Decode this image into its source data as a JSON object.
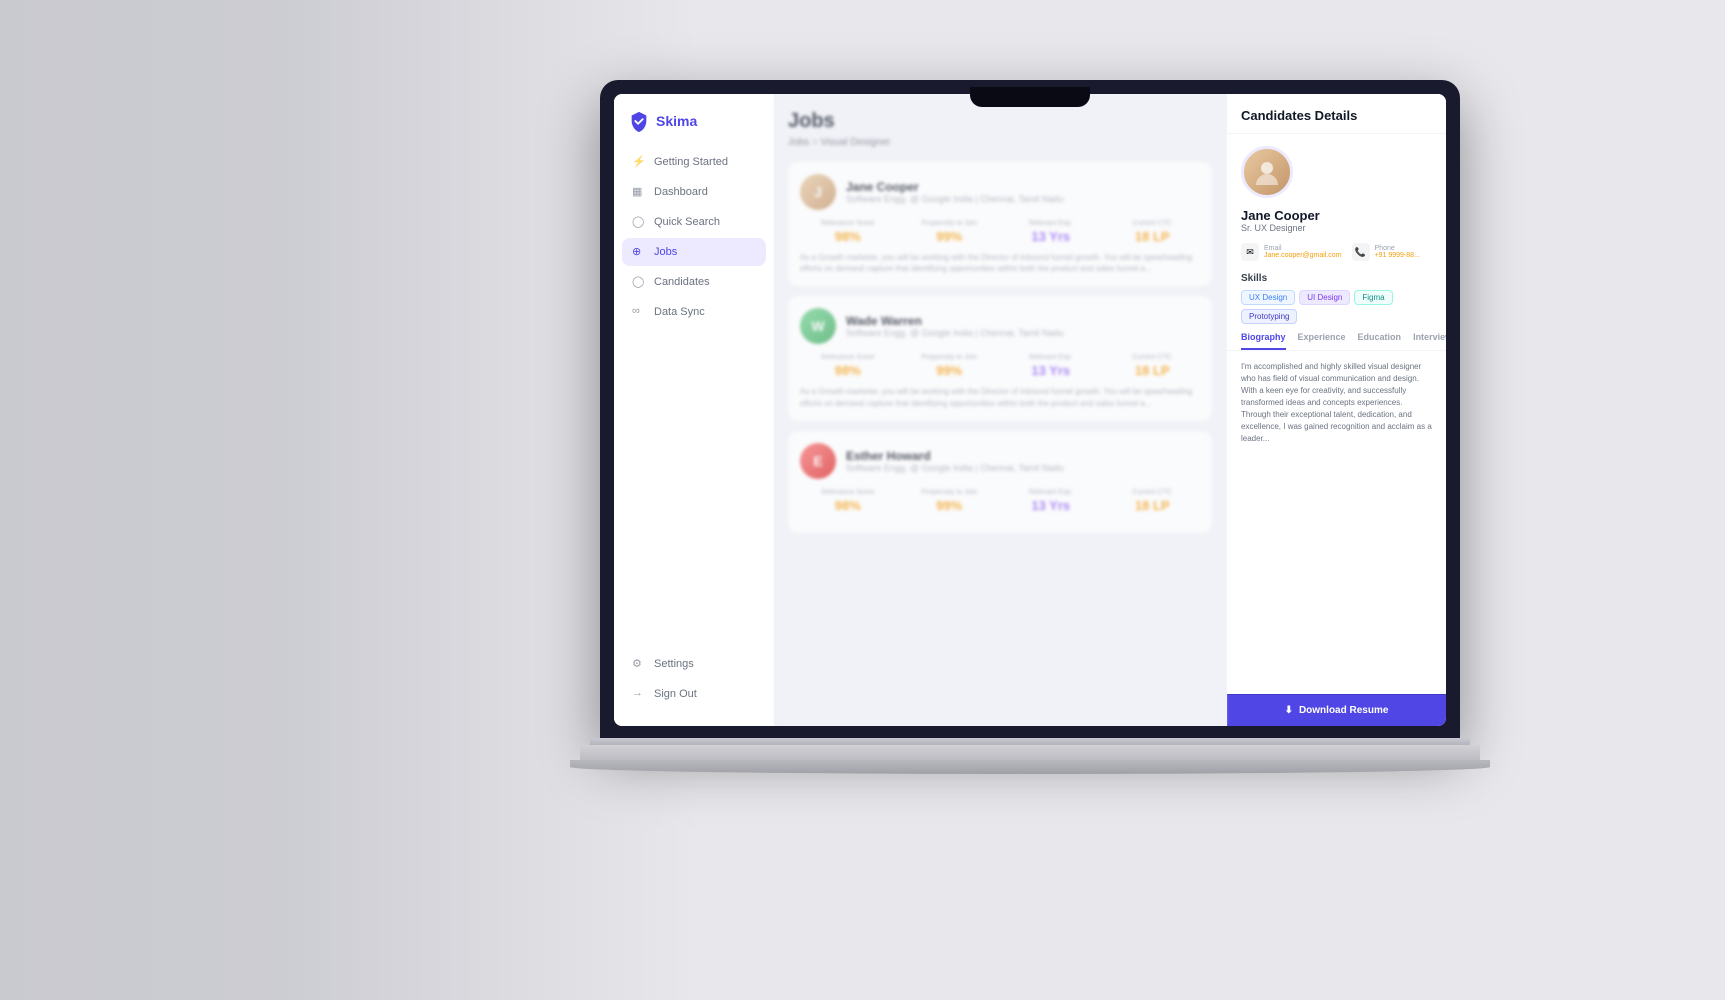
{
  "app": {
    "logo": "Skima",
    "page_title": "Jobs",
    "breadcrumb_parent": "Jobs",
    "breadcrumb_child": "Visual Designer"
  },
  "sidebar": {
    "items": [
      {
        "id": "getting-started",
        "label": "Getting Started",
        "icon": "⚡"
      },
      {
        "id": "dashboard",
        "label": "Dashboard",
        "icon": "⊞"
      },
      {
        "id": "quick-search",
        "label": "Quick Search",
        "icon": "○"
      },
      {
        "id": "jobs",
        "label": "Jobs",
        "icon": "⊕",
        "active": true
      },
      {
        "id": "candidates",
        "label": "Candidates",
        "icon": "○"
      },
      {
        "id": "data-sync",
        "label": "Data Sync",
        "icon": "∞"
      }
    ],
    "bottom_items": [
      {
        "id": "settings",
        "label": "Settings",
        "icon": "⚙"
      },
      {
        "id": "sign-out",
        "label": "Sign Out",
        "icon": "→"
      }
    ]
  },
  "candidates": [
    {
      "name": "Jane Cooper",
      "role": "Software Engg. @ Google India",
      "location": "Chennai, Tamil Nadu",
      "stats": {
        "relevance_score_label": "Relevance Score",
        "relevance_score": "98%",
        "propensity_label": "Propensity to Join",
        "propensity": "99%",
        "exp_label": "Relevant Exp.",
        "exp": "13 Yrs",
        "current_label": "Current CTC",
        "current": "18 LP"
      },
      "description": "As a Growth marketer, you will be working with the Director of Inbound funnel growth. You will be spearheading efforts on demand capture that identifying opportunities within both the product and sales funnel a..."
    },
    {
      "name": "Wade Warren",
      "role": "Software Engg. @ Google India",
      "location": "Chennai, Tamil Nadu",
      "stats": {
        "relevance_score_label": "Relevance Score",
        "relevance_score": "98%",
        "propensity_label": "Propensity to Join",
        "propensity": "99%",
        "exp_label": "Relevant Exp.",
        "exp": "13 Yrs",
        "current_label": "Current CTC",
        "current": "18 LP"
      },
      "description": "As a Growth marketer, you will be working with the Director of Inbound funnel growth. You will be spearheading efforts on demand capture that identifying opportunities within both the product and sales funnel a..."
    },
    {
      "name": "Esther Howard",
      "role": "Software Engg. @ Google India",
      "location": "Chennai, Tamil Nadu",
      "stats": {
        "relevance_score_label": "Relevance Score",
        "relevance_score": "98%",
        "propensity_label": "Propensity to Join",
        "propensity": "99%",
        "exp_label": "Relevant Exp.",
        "exp": "13 Yrs",
        "current_label": "Current CTC",
        "current": "18 LP"
      },
      "description": ""
    }
  ],
  "panel": {
    "title": "Candidates Details",
    "candidate": {
      "name": "Jane Cooper",
      "role": "Sr. UX Designer",
      "email_label": "Email",
      "email": "Jane.cooper@gmail.com",
      "phone_label": "Phone",
      "phone": "+91 9999-88...",
      "skills": [
        "UX Design",
        "UI Design",
        "Figma",
        "Prototyping"
      ]
    },
    "tabs": [
      "Biography",
      "Experience",
      "Education",
      "Interview"
    ],
    "biography": "I'm accomplished and highly skilled visual designer who has field of visual communication and design. With a keen eye for creativity, and successfully transformed ideas and concepts experiences. Through their exceptional talent, dedication, and excellence, I was gained recognition and acclaim as a leader...",
    "download_label": "Download Resume"
  },
  "colors": {
    "accent": "#4f46e5",
    "orange": "#f59e0b",
    "purple": "#8b5cf6",
    "green": "#10b981"
  }
}
